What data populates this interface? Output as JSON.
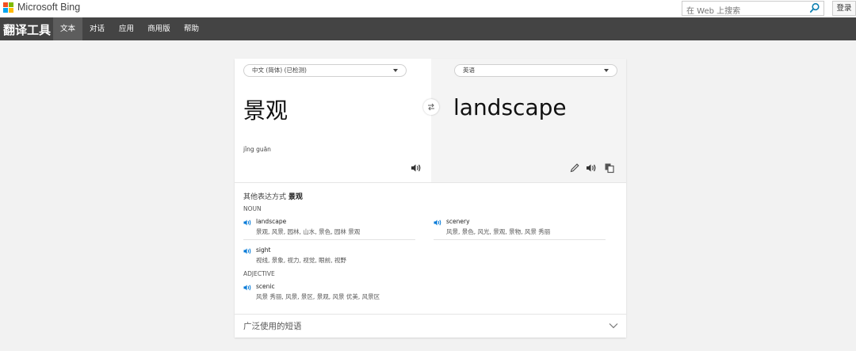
{
  "header": {
    "brand": "Microsoft Bing",
    "search_placeholder": "在 Web 上搜索",
    "login_label": "登录",
    "logo_colors": [
      "#f25022",
      "#7fba00",
      "#00a4ef",
      "#ffb900"
    ]
  },
  "nav": {
    "app_title": "翻译工具",
    "tabs": [
      {
        "label": "文本",
        "active": true
      },
      {
        "label": "对话",
        "active": false
      },
      {
        "label": "应用",
        "active": false
      },
      {
        "label": "商用版",
        "active": false
      },
      {
        "label": "帮助",
        "active": false
      }
    ]
  },
  "translator": {
    "source_lang": "中文 (简体) (已检测)",
    "target_lang": "英语",
    "source_text": "景观",
    "pinyin": "jǐng guān",
    "target_text": "landscape"
  },
  "alternates": {
    "title_prefix": "其他表达方式",
    "title_word": "景观",
    "noun_label": "NOUN",
    "adjective_label": "ADJECTIVE",
    "nouns": [
      {
        "word": "landscape",
        "translations": "景观, 风景, 园林, 山水, 景色, 园林 景观"
      },
      {
        "word": "scenery",
        "translations": "风景, 景色, 风光, 景观, 景物, 风景 秀丽"
      },
      {
        "word": "sight",
        "translations": "视线, 景象, 视力, 视觉, 眼前, 视野"
      }
    ],
    "adjectives": [
      {
        "word": "scenic",
        "translations": "风景 秀丽, 风景, 景区, 景观, 风景 优美, 风景区"
      }
    ]
  },
  "phrases": {
    "title": "广泛使用的短语"
  },
  "colors": {
    "accent": "#0078d7",
    "nav_bg": "#444444",
    "nav_active": "#5d5d5d"
  }
}
